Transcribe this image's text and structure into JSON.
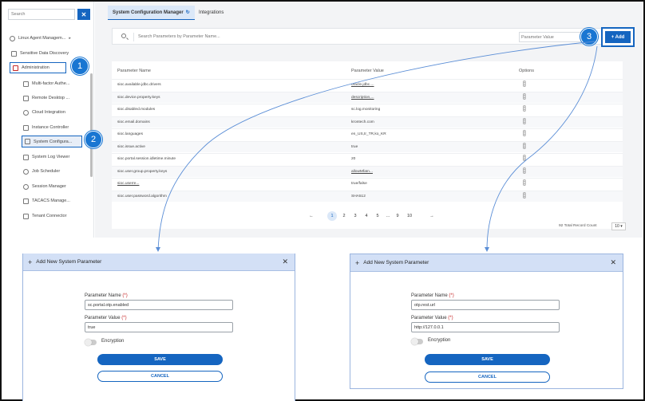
{
  "sidebar": {
    "search_placeholder": "Search",
    "close_label": "✕",
    "items": [
      {
        "label": "Linux Agent Managem...",
        "caret": "▸"
      },
      {
        "label": "Sensitive Data Discovery"
      },
      {
        "label": "Administration"
      },
      {
        "label": "Multi-factor Authe..."
      },
      {
        "label": "Remote Desktop ..."
      },
      {
        "label": "Cloud Integration"
      },
      {
        "label": "Instance Controller"
      },
      {
        "label": "System Configura..."
      },
      {
        "label": "System Log Viewer"
      },
      {
        "label": "Job Scheduler"
      },
      {
        "label": "Session Manager"
      },
      {
        "label": "TACACS Manage..."
      },
      {
        "label": "Tenant Connector"
      }
    ]
  },
  "badges": [
    "1",
    "2",
    "3"
  ],
  "tabs": {
    "system_config": "System Configuration Manager",
    "refresh_glyph": "↻",
    "integrations": "Integrations"
  },
  "filter": {
    "name_placeholder": "Search Parameters by Parameter Name...",
    "value_placeholder": "Parameter Value"
  },
  "add_button": "+ Add",
  "table": {
    "headers": [
      "Parameter Name",
      "Parameter Value",
      "Options"
    ],
    "options_glyph": "[:]",
    "rows": [
      {
        "name": "sioc.available.jdbc.drivers",
        "value": "oracle.jdbc...."
      },
      {
        "name": "sioc.device.property.keys",
        "value": "description,..."
      },
      {
        "name": "sioc.disabled.modules",
        "value": "sc.log.monitoring"
      },
      {
        "name": "sioc.email.domains",
        "value": "krontech.com"
      },
      {
        "name": "sioc.languages",
        "value": "en_US,tr_TR,ko_KR"
      },
      {
        "name": "sioc.issue.active",
        "value": "true"
      },
      {
        "name": "sioc.portal.session.idletime.minute",
        "value": "20"
      },
      {
        "name": "sioc.user.group.property.keys",
        "value": "allowMfaIn..."
      },
      {
        "name": "sioc.userre...",
        "value": "true/false"
      },
      {
        "name": "sioc.user.password.algorithm",
        "value": "SHA512"
      }
    ]
  },
  "pagination": {
    "prev": "←",
    "next": "→",
    "pages": [
      "1",
      "2",
      "3",
      "4",
      "5",
      "...",
      "9",
      "10"
    ],
    "active": "1",
    "total_info": "92 Total Record Count",
    "per_page": "10 ▾"
  },
  "dialogs": {
    "left": {
      "title": "Add New System Parameter",
      "name_label": "Parameter Name",
      "value_label": "Parameter Value",
      "required_mark": "(*)",
      "name_value": "sc.portal.otp.enabled",
      "value_value": "true",
      "encryption_label": "Encryption",
      "save_label": "SAVE",
      "cancel_label": "CANCEL"
    },
    "right": {
      "title": "Add New System Parameter",
      "name_label": "Parameter Name",
      "value_label": "Parameter Value",
      "required_mark": "(*)",
      "name_value": "otp.rest.url",
      "value_value": "http://127.0.0.1",
      "encryption_label": "Encryption",
      "save_label": "SAVE",
      "cancel_label": "CANCEL"
    },
    "close_glyph": "✕",
    "plus_glyph": "+"
  },
  "colors": {
    "accent": "#1565c0",
    "badge": "#1976d2",
    "dialog_header": "#d3e0f6"
  }
}
